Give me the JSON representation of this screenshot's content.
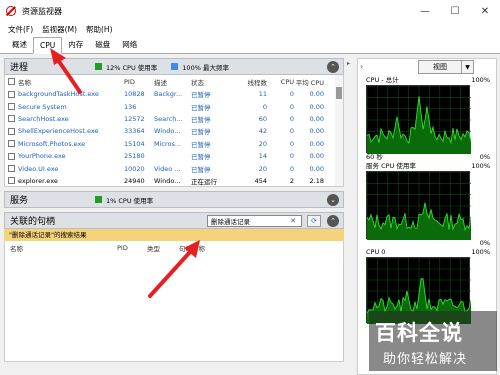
{
  "window": {
    "title": "资源监视器"
  },
  "menu": [
    "文件(F)",
    "监视器(M)",
    "帮助(H)"
  ],
  "tabs": [
    {
      "label": "概述",
      "active": false
    },
    {
      "label": "CPU",
      "active": true
    },
    {
      "label": "内存",
      "active": false
    },
    {
      "label": "磁盘",
      "active": false
    },
    {
      "label": "网络",
      "active": false
    }
  ],
  "processes": {
    "title": "进程",
    "cpu_usage": "12% CPU 使用率",
    "max_freq": "100% 最大频率",
    "columns": {
      "name": "名称",
      "pid": "PID",
      "desc": "描述",
      "status": "状态",
      "threads": "线程数",
      "cpu": "CPU",
      "avg_cpu": "平均 CPU"
    },
    "rows": [
      {
        "name": "backgroundTaskHost.exe",
        "pid": "10828",
        "desc": "Backgr...",
        "status": "已暂停",
        "threads": "11",
        "cpu": "0",
        "avg": "0.00",
        "suspended": true
      },
      {
        "name": "Secure System",
        "pid": "136",
        "desc": "",
        "status": "已暂停",
        "threads": "0",
        "cpu": "0",
        "avg": "0.00",
        "suspended": true
      },
      {
        "name": "SearchHost.exe",
        "pid": "12572",
        "desc": "Search...",
        "status": "已暂停",
        "threads": "60",
        "cpu": "0",
        "avg": "0.00",
        "suspended": true
      },
      {
        "name": "ShellExperienceHost.exe",
        "pid": "33364",
        "desc": "Windo...",
        "status": "已暂停",
        "threads": "42",
        "cpu": "0",
        "avg": "0.00",
        "suspended": true
      },
      {
        "name": "Microsoft.Photos.exe",
        "pid": "15104",
        "desc": "Micros...",
        "status": "已暂停",
        "threads": "20",
        "cpu": "0",
        "avg": "0.00",
        "suspended": true
      },
      {
        "name": "YourPhone.exe",
        "pid": "25180",
        "desc": "",
        "status": "已暂停",
        "threads": "14",
        "cpu": "0",
        "avg": "0.00",
        "suspended": true
      },
      {
        "name": "Video.UI.exe",
        "pid": "10020",
        "desc": "Video ...",
        "status": "已暂停",
        "threads": "20",
        "cpu": "0",
        "avg": "0.00",
        "suspended": true
      },
      {
        "name": "explorer.exe",
        "pid": "24940",
        "desc": "Windo...",
        "status": "正在运行",
        "threads": "454",
        "cpu": "2",
        "avg": "2.18",
        "suspended": false
      }
    ]
  },
  "services": {
    "title": "服务",
    "cpu_usage": "1% CPU 使用率"
  },
  "handles": {
    "title": "关联的句柄",
    "search_value": "删除通话记录",
    "result_banner": "\"删除通话记录\"的搜索结果",
    "columns": {
      "name": "名称",
      "pid": "PID",
      "type": "类型",
      "handle_name": "句柄名称"
    }
  },
  "right_panel": {
    "view_button": "视图",
    "cpu_total": {
      "label": "CPU - 总计",
      "max": "100%",
      "bottom_left": "60 秒",
      "bottom_right": "0%"
    },
    "service_cpu": {
      "label": "服务 CPU 使用率",
      "max": "100%",
      "bottom_right": "0%"
    },
    "cpu0": {
      "label": "CPU 0",
      "max": "100%"
    }
  },
  "watermark": {
    "big": "百科全说",
    "small": "助你轻松解决"
  },
  "colors": {
    "graph_line": "#2ce02c",
    "graph_fill": "#0b6b0b",
    "annotation_arrow": "#e62020",
    "banner": "#f5d37a"
  }
}
